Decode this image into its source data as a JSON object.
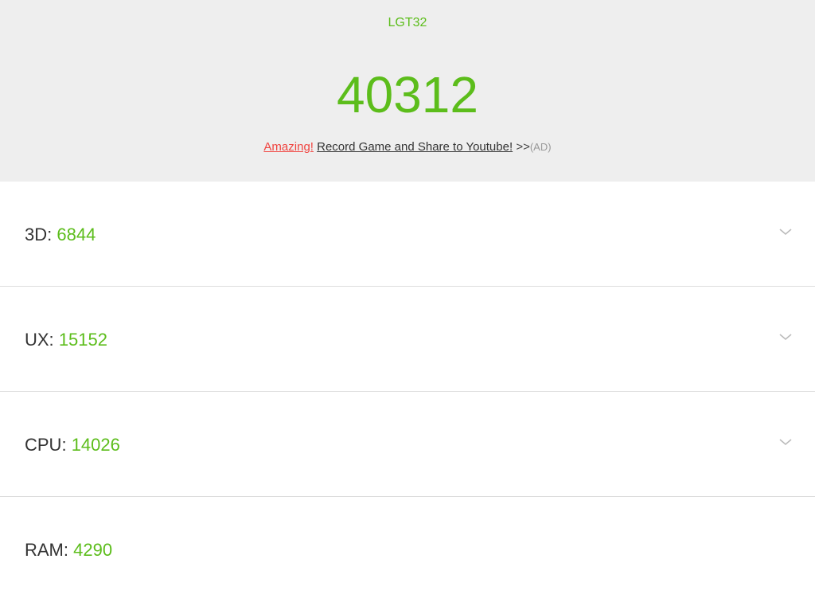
{
  "header": {
    "device_name": "LGT32",
    "total_score": "40312",
    "promo": {
      "amazing": "Amazing!",
      "link_text": "Record Game and Share to Youtube!",
      "arrows": ">>",
      "ad_tag": "(AD)"
    }
  },
  "scores": [
    {
      "label": "3D:",
      "value": "6844",
      "expandable": true
    },
    {
      "label": "UX:",
      "value": "15152",
      "expandable": true
    },
    {
      "label": "CPU:",
      "value": "14026",
      "expandable": true
    },
    {
      "label": "RAM:",
      "value": "4290",
      "expandable": false
    }
  ],
  "colors": {
    "accent_green": "#5cbd1b",
    "promo_red": "#f0433f",
    "header_bg": "#eeeeee",
    "divider": "#dddddd"
  },
  "icons": {
    "expand": "chevron-down-icon"
  }
}
